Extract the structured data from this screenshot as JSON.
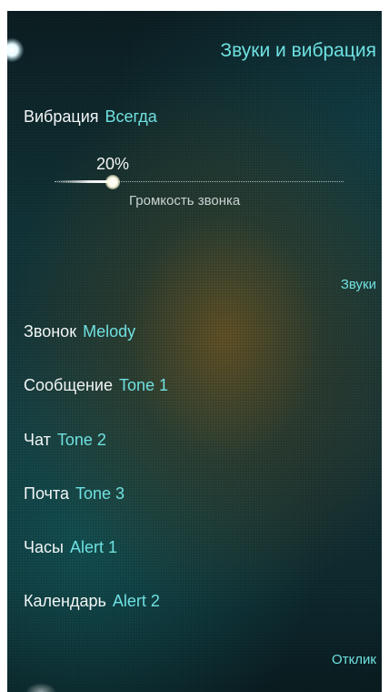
{
  "header": {
    "title": "Звуки и вибрация"
  },
  "vibration": {
    "label": "Вибрация",
    "value": "Всегда"
  },
  "ring_volume": {
    "percent_text": "20%",
    "level": 0.2,
    "caption": "Громкость звонка"
  },
  "sounds_section": {
    "title": "Звуки"
  },
  "sounds": [
    {
      "label": "Звонок",
      "value": "Melody"
    },
    {
      "label": "Сообщение",
      "value": "Tone 1"
    },
    {
      "label": "Чат",
      "value": "Tone 2"
    },
    {
      "label": "Почта",
      "value": "Tone 3"
    },
    {
      "label": "Часы",
      "value": "Alert 1"
    },
    {
      "label": "Календарь",
      "value": "Alert 2"
    }
  ],
  "feedback_section": {
    "title": "Отклик"
  },
  "colors": {
    "accent": "#6fe0e0",
    "text": "#f2f5f5",
    "caption": "#c9d2d2"
  }
}
